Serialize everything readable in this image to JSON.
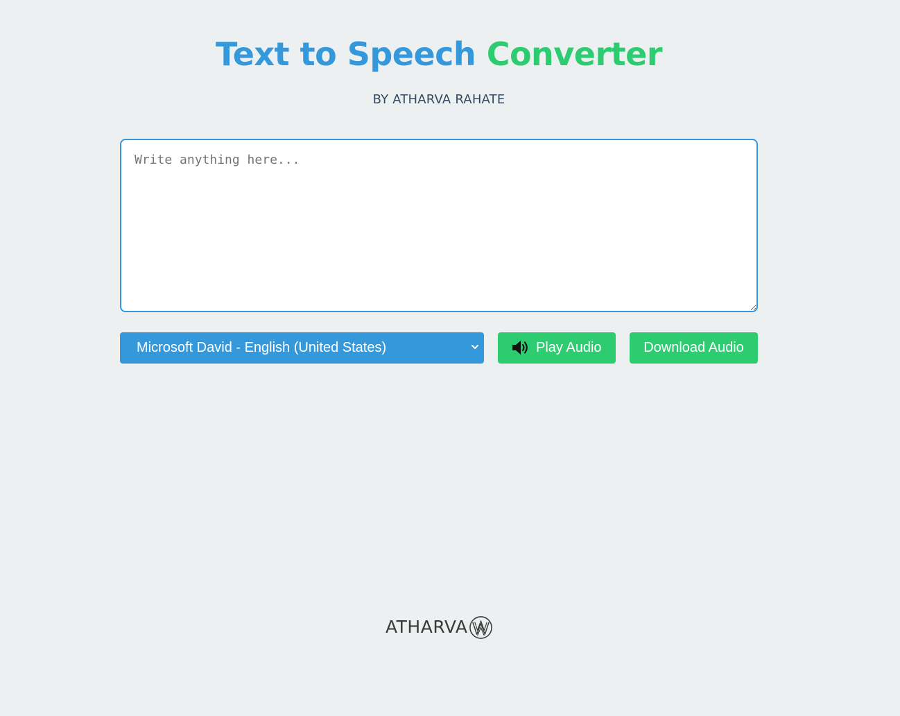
{
  "header": {
    "title_part1": "Text to Speech",
    "title_part2": "Converter",
    "subtitle": "BY ATHARVA RAHATE"
  },
  "editor": {
    "placeholder": "Write anything here...",
    "value": ""
  },
  "controls": {
    "voice_selected": "Microsoft David - English (United States)",
    "play_label": "Play Audio",
    "download_label": "Download Audio"
  },
  "footer": {
    "logo_text": "ATHARVA"
  },
  "colors": {
    "background": "#ecf0f1",
    "primary_blue": "#3498db",
    "accent_green": "#2ecc71",
    "subtitle_text": "#34495e"
  }
}
